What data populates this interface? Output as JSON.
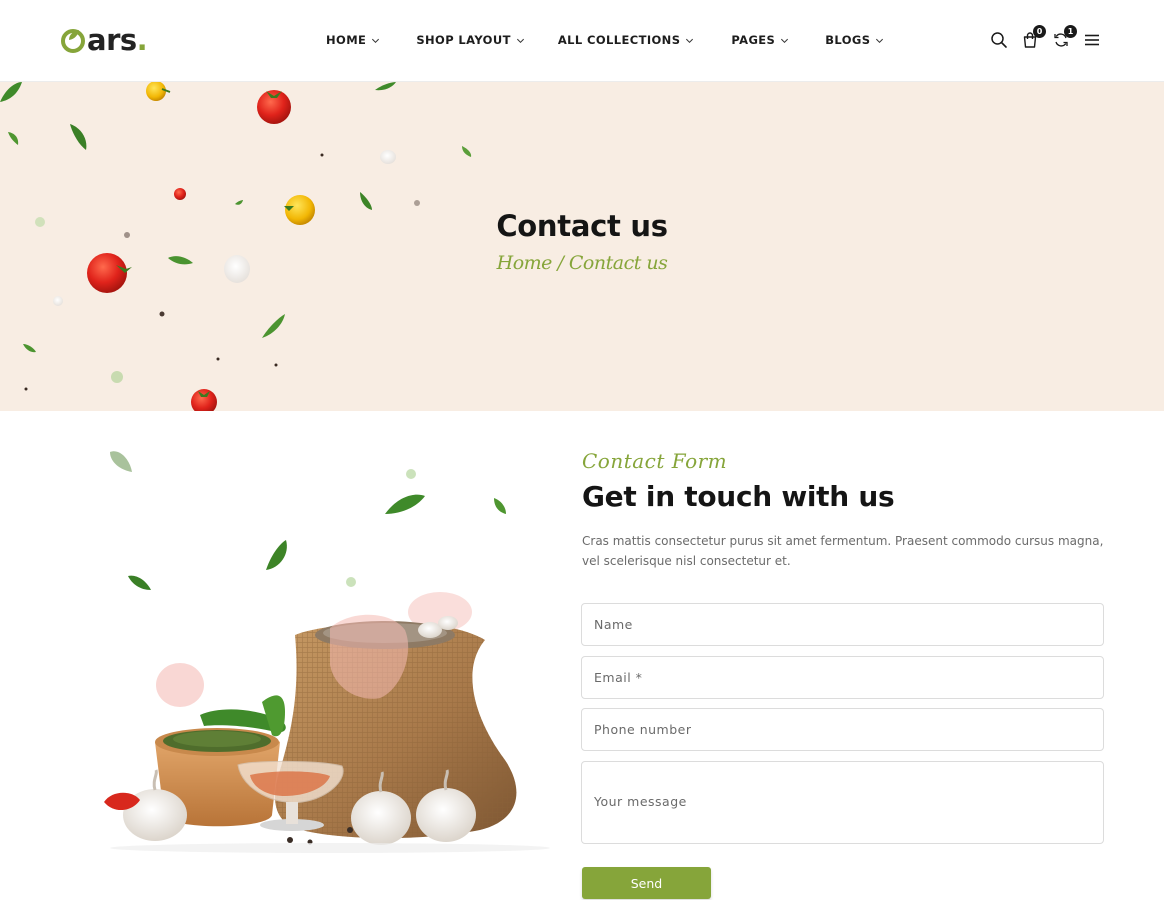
{
  "header": {
    "logo_text": "ars",
    "logo_dot": ".",
    "nav": [
      {
        "label": "HOME"
      },
      {
        "label": "SHOP LAYOUT"
      },
      {
        "label": "ALL COLLECTIONS"
      },
      {
        "label": "PAGES"
      },
      {
        "label": "BLOGS"
      }
    ],
    "icons": {
      "search": "search-icon",
      "cart": "bag-icon",
      "cart_count": "0",
      "compare": "refresh-icon",
      "compare_count": "1",
      "menu": "hamburger-menu-icon"
    }
  },
  "banner": {
    "title": "Contact us",
    "breadcrumb": {
      "home": "Home",
      "separator": " / ",
      "current": "Contact us"
    }
  },
  "contact": {
    "script_label": "Contact Form",
    "title": "Get in touch with us",
    "description": "Cras mattis consectetur purus sit amet fermentum. Praesent commodo cursus magna, vel scelerisque nisl consectetur et.",
    "fields": {
      "name_placeholder": "Name",
      "email_placeholder": "Email *",
      "phone_placeholder": "Phone number",
      "message_placeholder": "Your message"
    },
    "send_label": "Send"
  },
  "colors": {
    "accent": "#86a53a",
    "banner_bg": "#f8ede3",
    "text_dark": "#151515"
  }
}
